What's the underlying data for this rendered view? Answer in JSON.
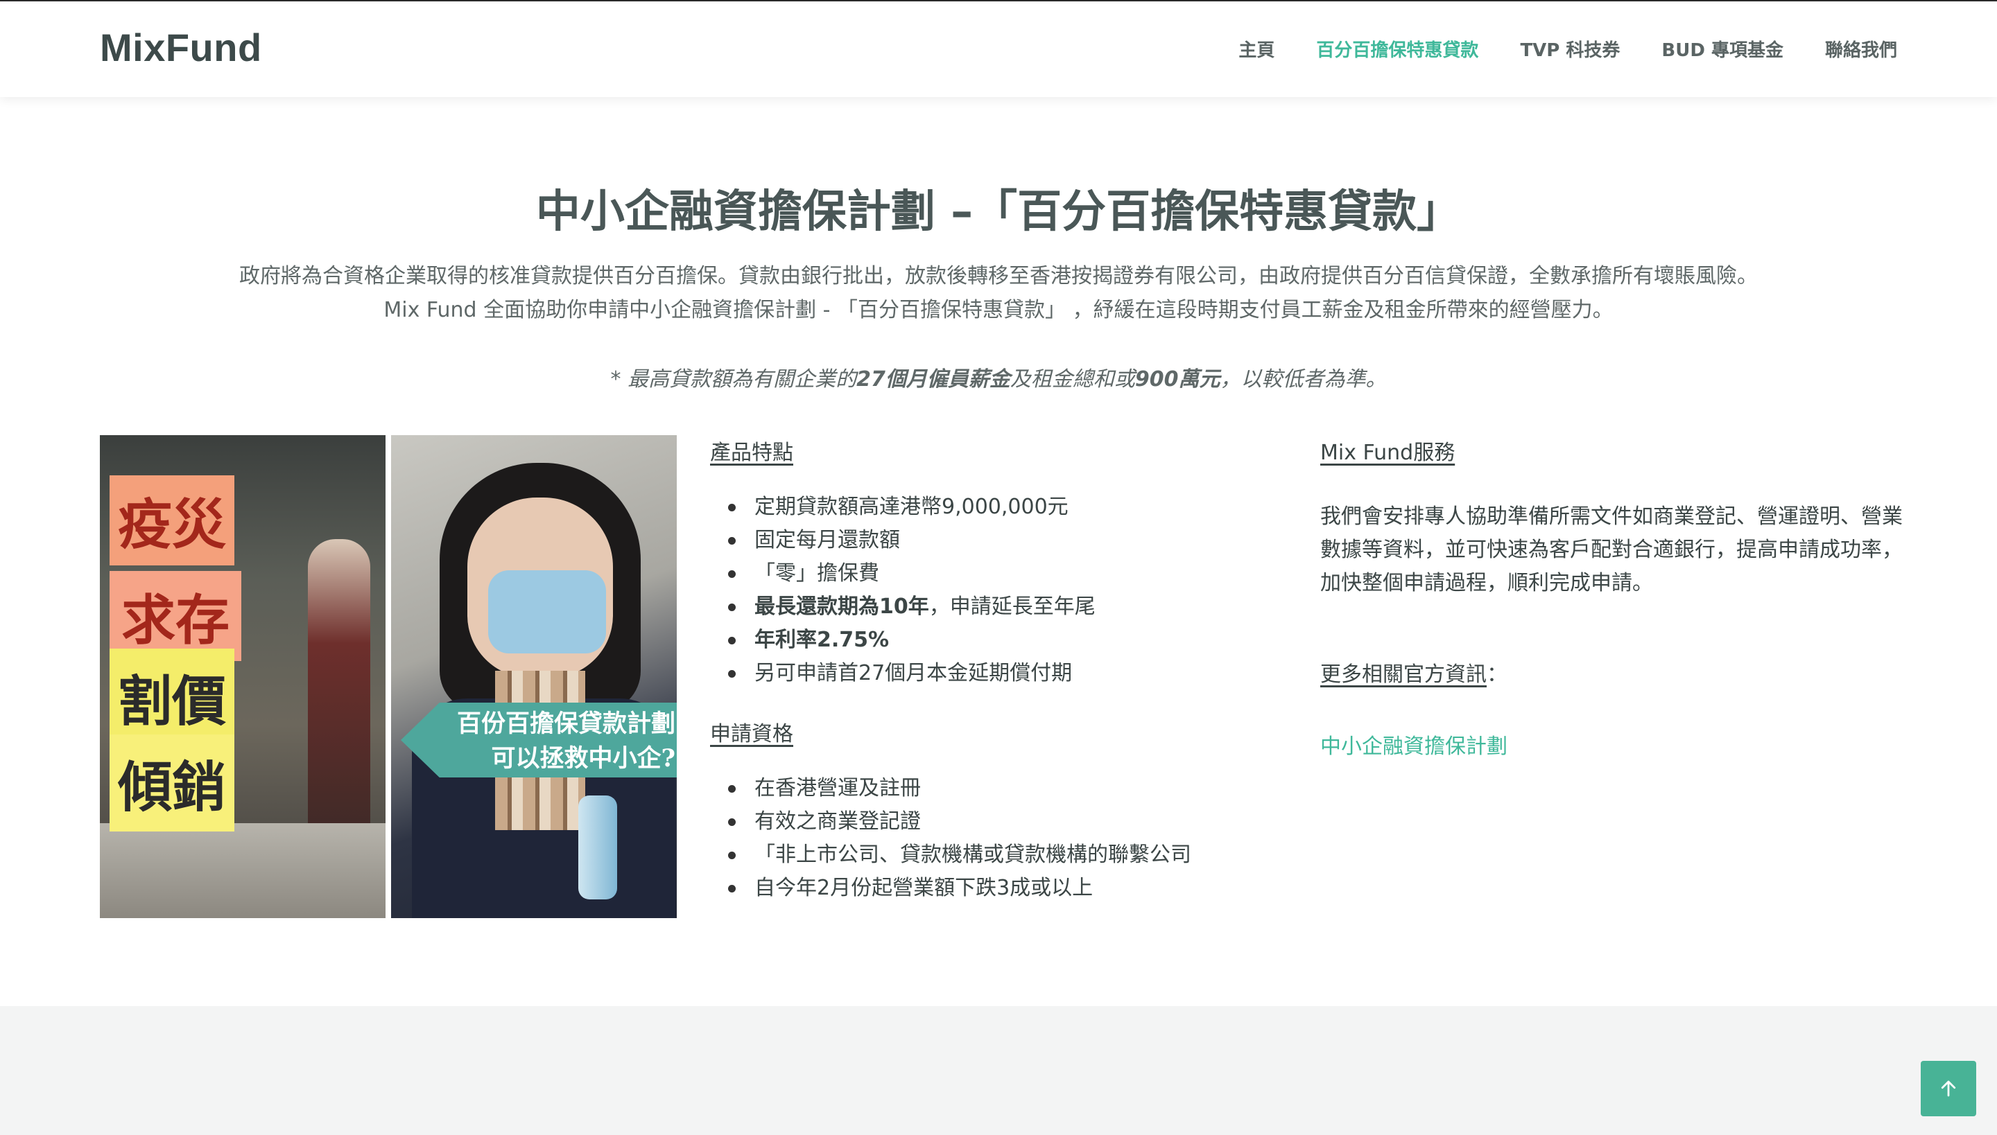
{
  "header": {
    "logo": "MixFund",
    "nav": [
      {
        "label": "主頁",
        "active": false
      },
      {
        "label": "百分百擔保特惠貸款",
        "active": true
      },
      {
        "label": "TVP 科技券",
        "active": false
      },
      {
        "label": "BUD 專項基金",
        "active": false
      },
      {
        "label": "聯絡我們",
        "active": false
      }
    ]
  },
  "hero": {
    "title": "中小企融資擔保計劃 –「百分百擔保特惠貸款」",
    "intro_line1": "政府將為合資格企業取得的核准貸款提供百分百擔保。貸款由銀行批出，放款後轉移至香港按揭證券有限公司，由政府提供百分百信貸保證，全數承擔所有壞賬風險。",
    "intro_line2": "Mix Fund 全面協助你申請中小企融資擔保計劃 - 「百分百擔保特惠貸款」 ，紓緩在這段時期支付員工薪金及租金所帶來的經營壓力。",
    "note_part1": "* 最高貸款額為有關企業的",
    "note_bold1": "27個月僱員薪金",
    "note_part2": "及租金總和或",
    "note_bold2": "900萬元",
    "note_part3": "，以較低者為準。"
  },
  "images": {
    "left_signs": [
      "疫災",
      "求存",
      "割價",
      "傾銷"
    ],
    "banner_line1": "百份百擔保貸款計劃",
    "banner_line2": "可以拯救中小企?"
  },
  "features": {
    "heading": "產品特點",
    "items": [
      {
        "text": "定期貸款額高達港幣9,000,000元"
      },
      {
        "text": "固定每月還款額"
      },
      {
        "text": "「零」擔保費"
      },
      {
        "bold": "最長還款期為10年",
        "text": "，申請延長至年尾"
      },
      {
        "bold": "年利率2.75%"
      },
      {
        "text": "另可申請首27個月本金延期償付期"
      }
    ]
  },
  "eligibility": {
    "heading": "申請資格",
    "items": [
      "在香港營運及註冊",
      "有效之商業登記證",
      "「非上市公司、貸款機構或貸款機構的聯繫公司",
      "自今年2月份起營業額下跌3成或以上"
    ]
  },
  "service": {
    "heading": "Mix Fund服務",
    "text": "我們會安排專人協助準備所需文件如商業登記、營運證明、營業數據等資料，並可快速為客戶配對合適銀行，提高申請成功率，加快整個申請過程，順利完成申請。",
    "more_label": "更多相關官方資訊",
    "more_colon": "：",
    "official_link": "中小企融資擔保計劃"
  },
  "colors": {
    "accent": "#3fb89a",
    "to_top_bg": "#48b396",
    "footer_band": "#f3f4f4"
  },
  "icons": {
    "to_top": "arrow-up-icon"
  }
}
